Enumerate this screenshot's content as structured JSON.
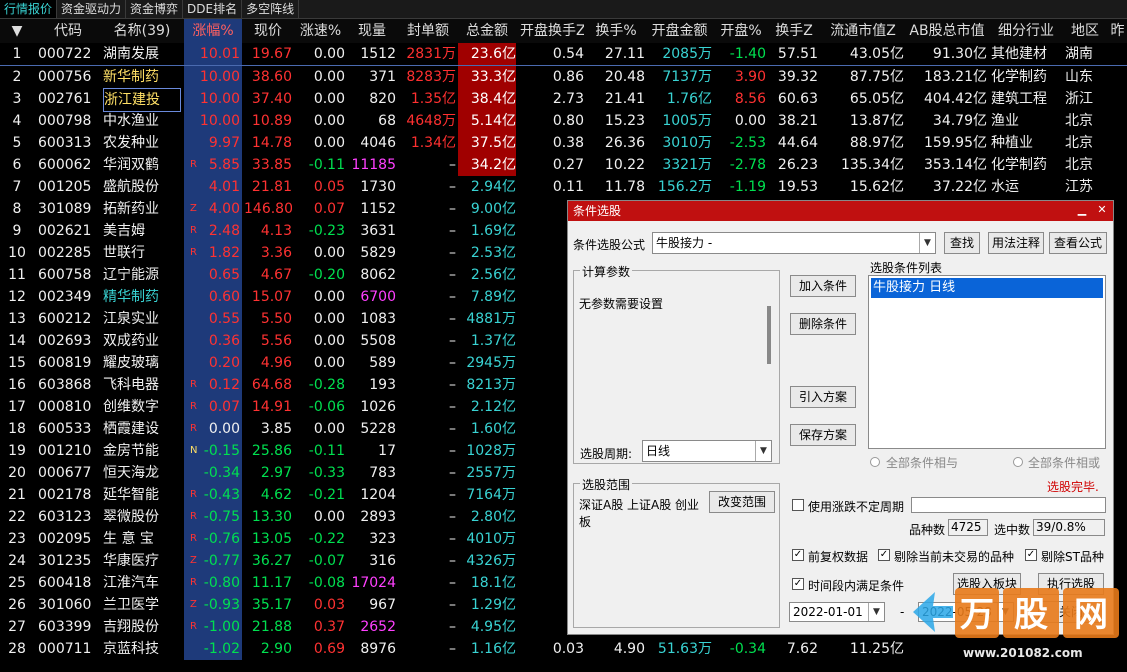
{
  "tabs": [
    "行情报价",
    "资金驱动力",
    "资金博弈",
    "DDE排名",
    "多空阵线"
  ],
  "columns": {
    "arrow": "▼",
    "code": "代码",
    "name": "名称(39)",
    "pct": "涨幅%",
    "price": "现价",
    "speed": "涨速%",
    "vol": "现量",
    "seal": "封单额",
    "amount": "总金额",
    "open_turn": "开盘换手Z",
    "turnover": "换手%",
    "open_amt": "开盘金额",
    "open_pct": "开盘%",
    "turn_z": "换手Z",
    "float_cap": "流通市值Z",
    "ab_cap": "AB股总市值",
    "industry": "细分行业",
    "region": "地区",
    "extra": "昨"
  },
  "rows": [
    {
      "no": "1",
      "code": "000722",
      "name": "湖南发展",
      "tag": "",
      "pct": "10.01",
      "price": "19.67",
      "speed": "0.00",
      "vol": "1512",
      "seal": "2831万",
      "amount": "23.6亿",
      "open_turn": "0.54",
      "turnover": "27.11",
      "open_amt": "2085万",
      "open_pct": "-1.40",
      "turn_z": "57.51",
      "float_cap": "43.05亿",
      "ab_cap": "91.30亿",
      "industry": "其他建材",
      "region": "湖南"
    },
    {
      "no": "2",
      "code": "000756",
      "name": "新华制药",
      "tag": "",
      "pct": "10.00",
      "price": "38.60",
      "speed": "0.00",
      "vol": "371",
      "seal": "8283万",
      "amount": "33.3亿",
      "open_turn": "0.86",
      "turnover": "20.48",
      "open_amt": "7137万",
      "open_pct": "3.90",
      "turn_z": "39.32",
      "float_cap": "87.75亿",
      "ab_cap": "183.21亿",
      "industry": "化学制药",
      "region": "山东"
    },
    {
      "no": "3",
      "code": "002761",
      "name": "浙江建投",
      "tag": "",
      "pct": "10.00",
      "price": "37.40",
      "speed": "0.00",
      "vol": "820",
      "seal": "1.35亿",
      "amount": "38.4亿",
      "open_turn": "2.73",
      "turnover": "21.41",
      "open_amt": "1.76亿",
      "open_pct": "8.56",
      "turn_z": "60.63",
      "float_cap": "65.05亿",
      "ab_cap": "404.42亿",
      "industry": "建筑工程",
      "region": "浙江"
    },
    {
      "no": "4",
      "code": "000798",
      "name": "中水渔业",
      "tag": "",
      "pct": "10.00",
      "price": "10.89",
      "speed": "0.00",
      "vol": "68",
      "seal": "4648万",
      "amount": "5.14亿",
      "open_turn": "0.80",
      "turnover": "15.23",
      "open_amt": "1005万",
      "open_pct": "0.00",
      "turn_z": "38.21",
      "float_cap": "13.87亿",
      "ab_cap": "34.79亿",
      "industry": "渔业",
      "region": "北京"
    },
    {
      "no": "5",
      "code": "600313",
      "name": "农发种业",
      "tag": "",
      "pct": "9.97",
      "price": "14.78",
      "speed": "0.00",
      "vol": "4046",
      "seal": "1.34亿",
      "amount": "37.5亿",
      "open_turn": "0.38",
      "turnover": "26.36",
      "open_amt": "3010万",
      "open_pct": "-2.53",
      "turn_z": "44.64",
      "float_cap": "88.97亿",
      "ab_cap": "159.95亿",
      "industry": "种植业",
      "region": "北京"
    },
    {
      "no": "6",
      "code": "600062",
      "name": "华润双鹤",
      "tag": "R",
      "pct": "5.85",
      "price": "33.85",
      "speed": "-0.11",
      "vol": "11185",
      "seal": "–",
      "amount": "34.2亿",
      "open_turn": "0.27",
      "turnover": "10.22",
      "open_amt": "3321万",
      "open_pct": "-2.78",
      "turn_z": "26.23",
      "float_cap": "135.34亿",
      "ab_cap": "353.14亿",
      "industry": "化学制药",
      "region": "北京"
    },
    {
      "no": "7",
      "code": "001205",
      "name": "盛航股份",
      "tag": "",
      "pct": "4.01",
      "price": "21.81",
      "speed": "0.05",
      "vol": "1730",
      "seal": "–",
      "amount": "2.94亿",
      "open_turn": "0.11",
      "turnover": "11.78",
      "open_amt": "156.2万",
      "open_pct": "-1.19",
      "turn_z": "19.53",
      "float_cap": "15.62亿",
      "ab_cap": "37.22亿",
      "industry": "水运",
      "region": "江苏"
    },
    {
      "no": "8",
      "code": "301089",
      "name": "拓新药业",
      "tag": "Z",
      "pct": "4.00",
      "price": "146.80",
      "speed": "0.07",
      "vol": "1152",
      "seal": "–",
      "amount": "9.00亿"
    },
    {
      "no": "9",
      "code": "002621",
      "name": "美吉姆",
      "tag": "R",
      "pct": "2.48",
      "price": "4.13",
      "speed": "-0.23",
      "vol": "3631",
      "seal": "–",
      "amount": "1.69亿"
    },
    {
      "no": "10",
      "code": "002285",
      "name": "世联行",
      "tag": "R",
      "pct": "1.82",
      "price": "3.36",
      "speed": "0.00",
      "vol": "5829",
      "seal": "–",
      "amount": "2.53亿"
    },
    {
      "no": "11",
      "code": "600758",
      "name": "辽宁能源",
      "tag": "",
      "pct": "0.65",
      "price": "4.67",
      "speed": "-0.20",
      "vol": "8062",
      "seal": "–",
      "amount": "2.56亿"
    },
    {
      "no": "12",
      "code": "002349",
      "name": "精华制药",
      "tag": "",
      "pct": "0.60",
      "price": "15.07",
      "speed": "0.00",
      "vol": "6700",
      "seal": "–",
      "amount": "7.89亿"
    },
    {
      "no": "13",
      "code": "600212",
      "name": "江泉实业",
      "tag": "",
      "pct": "0.55",
      "price": "5.50",
      "speed": "0.00",
      "vol": "1083",
      "seal": "–",
      "amount": "4881万"
    },
    {
      "no": "14",
      "code": "002693",
      "name": "双成药业",
      "tag": "",
      "pct": "0.36",
      "price": "5.56",
      "speed": "0.00",
      "vol": "5508",
      "seal": "–",
      "amount": "1.37亿"
    },
    {
      "no": "15",
      "code": "600819",
      "name": "耀皮玻璃",
      "tag": "",
      "pct": "0.20",
      "price": "4.96",
      "speed": "0.00",
      "vol": "589",
      "seal": "–",
      "amount": "2945万"
    },
    {
      "no": "16",
      "code": "603868",
      "name": "飞科电器",
      "tag": "R",
      "pct": "0.12",
      "price": "64.68",
      "speed": "-0.28",
      "vol": "193",
      "seal": "–",
      "amount": "8213万"
    },
    {
      "no": "17",
      "code": "000810",
      "name": "创维数字",
      "tag": "R",
      "pct": "0.07",
      "price": "14.91",
      "speed": "-0.06",
      "vol": "1026",
      "seal": "–",
      "amount": "2.12亿"
    },
    {
      "no": "18",
      "code": "600533",
      "name": "栖霞建设",
      "tag": "R",
      "pct": "0.00",
      "price": "3.85",
      "speed": "0.00",
      "vol": "5228",
      "seal": "–",
      "amount": "1.60亿"
    },
    {
      "no": "19",
      "code": "001210",
      "name": "金房节能",
      "tag": "N",
      "pct": "-0.15",
      "price": "25.86",
      "speed": "-0.11",
      "vol": "17",
      "seal": "–",
      "amount": "1028万"
    },
    {
      "no": "20",
      "code": "000677",
      "name": "恒天海龙",
      "tag": "",
      "pct": "-0.34",
      "price": "2.97",
      "speed": "-0.33",
      "vol": "783",
      "seal": "–",
      "amount": "2557万"
    },
    {
      "no": "21",
      "code": "002178",
      "name": "延华智能",
      "tag": "R",
      "pct": "-0.43",
      "price": "4.62",
      "speed": "-0.21",
      "vol": "1204",
      "seal": "–",
      "amount": "7164万"
    },
    {
      "no": "22",
      "code": "603123",
      "name": "翠微股份",
      "tag": "R",
      "pct": "-0.75",
      "price": "13.30",
      "speed": "0.00",
      "vol": "2893",
      "seal": "–",
      "amount": "2.80亿"
    },
    {
      "no": "23",
      "code": "002095",
      "name": "生 意 宝",
      "tag": "R",
      "pct": "-0.76",
      "price": "13.05",
      "speed": "-0.22",
      "vol": "323",
      "seal": "–",
      "amount": "4010万"
    },
    {
      "no": "24",
      "code": "301235",
      "name": "华康医疗",
      "tag": "Z",
      "pct": "-0.77",
      "price": "36.27",
      "speed": "-0.07",
      "vol": "316",
      "seal": "–",
      "amount": "4326万"
    },
    {
      "no": "25",
      "code": "600418",
      "name": "江淮汽车",
      "tag": "R",
      "pct": "-0.80",
      "price": "11.17",
      "speed": "-0.08",
      "vol": "17024",
      "seal": "–",
      "amount": "18.1亿"
    },
    {
      "no": "26",
      "code": "301060",
      "name": "兰卫医学",
      "tag": "Z",
      "pct": "-0.93",
      "price": "35.17",
      "speed": "0.03",
      "vol": "967",
      "seal": "–",
      "amount": "1.29亿"
    },
    {
      "no": "27",
      "code": "603399",
      "name": "吉翔股份",
      "tag": "R",
      "pct": "-1.00",
      "price": "21.88",
      "speed": "0.37",
      "vol": "2652",
      "seal": "–",
      "amount": "4.95亿"
    },
    {
      "no": "28",
      "code": "000711",
      "name": "京蓝科技",
      "tag": "",
      "pct": "-1.02",
      "price": "2.90",
      "speed": "0.69",
      "vol": "8976",
      "seal": "–",
      "amount": "1.16亿",
      "open_turn": "0.03",
      "turnover": "4.90",
      "open_amt": "51.63万",
      "open_pct": "-0.34",
      "turn_z": "7.62",
      "float_cap": "11.25亿",
      "ab_cap": "",
      "industry": "",
      "region": ""
    }
  ],
  "dialog": {
    "title": "条件选股",
    "formula_label": "条件选股公式",
    "formula_value": "牛股接力      -",
    "find_btn": "查找",
    "usage_btn": "用法注释",
    "view_btn": "查看公式",
    "params_legend": "计算参数",
    "params_text": "无参数需要设置",
    "period_label": "选股周期:",
    "period_value": "日线",
    "add_btn": "加入条件",
    "del_btn": "删除条件",
    "import_btn": "引入方案",
    "save_btn": "保存方案",
    "list_label": "选股条件列表",
    "list_item": "牛股接力  日线",
    "radio_and": "全部条件相与",
    "radio_or": "全部条件相或",
    "done_text": "选股完毕.",
    "range_legend": "选股范围",
    "range_text": "深证A股 上证A股 创业板",
    "change_range_btn": "改变范围",
    "uncertain_period": "使用涨跌不定周期",
    "count_label": "品种数",
    "count_value": "4725",
    "selected_label": "选中数",
    "selected_value": "39/0.8%",
    "cb_fq": "前复权数据",
    "cb_exclude_notrade": "剔除当前未交易的品种",
    "cb_exclude_st": "剔除ST品种",
    "cb_period": "时间段内满足条件",
    "to_block_btn": "选股入板块",
    "exec_btn": "执行选股",
    "date_from": "2022-01-01",
    "date_sep": "-",
    "date_to": "2022-05-28",
    "close_btn": "关闭"
  },
  "watermark": {
    "brand": "股",
    "url": "www.201082.com"
  }
}
